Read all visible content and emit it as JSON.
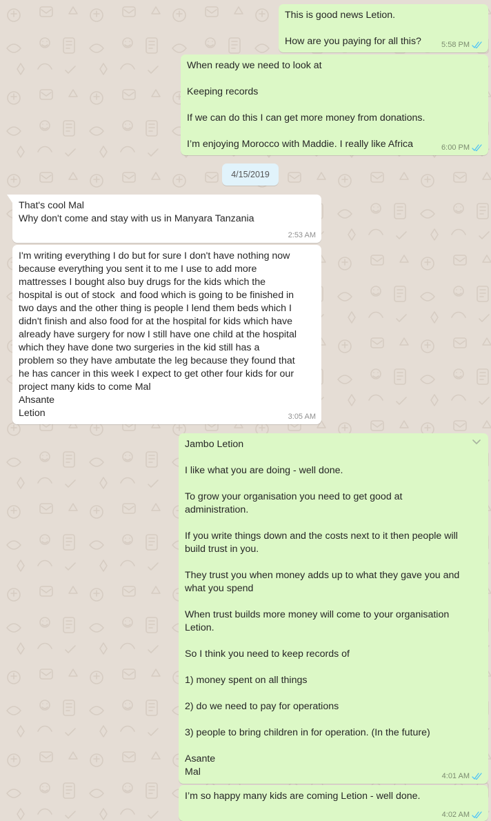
{
  "chat": {
    "date_divider": "4/15/2019",
    "messages": [
      {
        "direction": "outgoing",
        "text": "This is good news Letion.\n\nHow are you paying for all this?",
        "time": "5:58 PM",
        "status": "read"
      },
      {
        "direction": "outgoing",
        "text": "When ready we need to look at\n\nKeeping records\n\nIf we can do this I can get more money from donations.\n\nI’m enjoying Morocco with Maddie. I really like Africa",
        "time": "6:00 PM",
        "status": "read"
      },
      {
        "direction": "incoming",
        "text": "That's cool Mal\nWhy don't come and stay with us in Manyara Tanzania",
        "time": "2:53 AM"
      },
      {
        "direction": "incoming",
        "text": "I'm writing everything I do but for sure I don't have nothing now\nbecause everything you sent it to me I use to add more\nmattresses I bought also buy drugs for the kids which the\nhospital is out of stock  and food which is going to be finished in\ntwo days and the other thing is people I lend them beds which I\ndidn't finish and also food for at the hospital for kids which have\nalready have surgery for now I still have one child at the hospital\nwhich they have done two surgeries in the kid still has a\nproblem so they have ambutate the leg because they found that\nhe has cancer in this week I expect to get other four kids for our\nproject many kids to come Mal\nAhsante\nLetion",
        "time": "3:05 AM"
      },
      {
        "direction": "outgoing",
        "text": "Jambo Letion\n\nI like what you are doing - well done.\n\nTo grow your organisation you need to get good at\nadministration.\n\nIf you write things down and the costs next to it then people will\nbuild trust in you.\n\nThey trust you when money adds up to what they gave you and\nwhat you spend\n\nWhen trust builds more money will come to your organisation\nLetion.\n\nSo I think you need to keep records of\n\n1) money spent on all things\n\n2) do we need to pay for operations\n\n3) people to bring children in for operation. (In the future)\n\nAsante\nMal",
        "time": "4:01 AM",
        "status": "read",
        "menu_icon": "chevron-down-icon"
      },
      {
        "direction": "outgoing",
        "text": "I’m so happy many kids are coming Letion - well done.",
        "time": "4:02 AM",
        "status": "read"
      }
    ]
  },
  "colors": {
    "background": "#e5ddd5",
    "outgoing_bubble": "#dcf8c6",
    "incoming_bubble": "#ffffff",
    "read_ticks": "#4fc3f7",
    "date_chip": "#e1f3fb"
  }
}
